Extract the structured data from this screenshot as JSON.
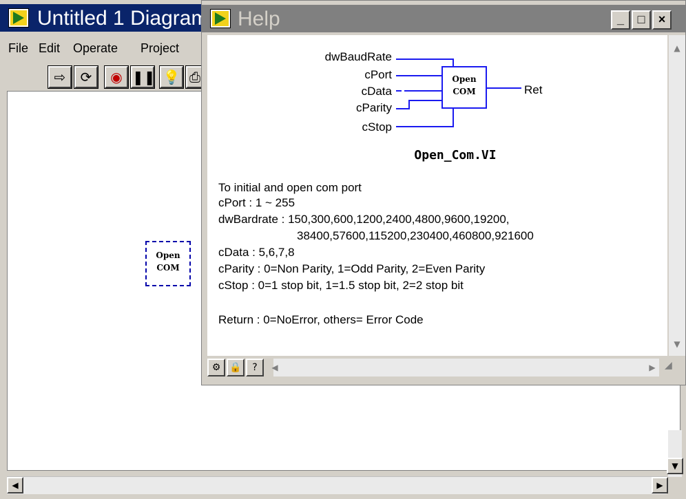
{
  "diagram_window": {
    "title": "Untitled 1 Diagram",
    "menu": {
      "file": "File",
      "edit": "Edit",
      "operate": "Operate",
      "project": "Project"
    },
    "toolbar": [
      "⇨",
      "⟳",
      "◉",
      "❚❚",
      "💡",
      "⎙"
    ],
    "node": {
      "line1": "Open",
      "line2": "COM"
    }
  },
  "help_window": {
    "title": "Help",
    "caption_buttons": {
      "minimize": "_",
      "maximize": "□",
      "close": "×"
    },
    "terminals": {
      "baud": "dwBaudRate",
      "port": "cPort",
      "data": "cData",
      "parity": "cParity",
      "stop": "cStop",
      "ret": "Ret"
    },
    "node": {
      "line1": "Open",
      "line2": "COM"
    },
    "vi_name": "Open_Com.VI",
    "description": [
      "To initial and open com port",
      "cPort : 1 ~ 255",
      "dwBardrate : 150,300,600,1200,2400,4800,9600,19200,",
      "38400,57600,115200,230400,460800,921600",
      "cData : 5,6,7,8",
      "cParity : 0=Non Parity, 1=Odd Parity, 2=Even Parity",
      "cStop : 0=1 stop bit, 1=1.5 stop bit, 2=2 stop bit",
      "Return : 0=NoError, others= Error Code"
    ],
    "bottom_buttons": [
      "⚙",
      "🔒",
      "?"
    ]
  }
}
